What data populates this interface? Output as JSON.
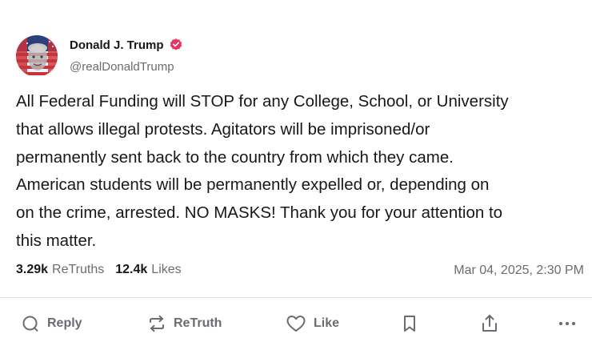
{
  "author": {
    "display_name": "Donald J. Trump",
    "handle": "@realDonaldTrump",
    "verified": true,
    "verified_color": "#e8345f"
  },
  "post": {
    "lines": [
      "All Federal Funding will STOP for any College, School, or University",
      "that allows illegal protests. Agitators will be imprisoned/or",
      "permanently sent back to the country from which they came.",
      "American students will be permanently expelled or, depending on",
      "on the crime, arrested. NO MASKS! Thank you for your attention to",
      "this matter."
    ]
  },
  "stats": {
    "retruths_count": "3.29k",
    "retruths_label": "ReTruths",
    "likes_count": "12.4k",
    "likes_label": "Likes"
  },
  "timestamp": "Mar 04, 2025, 2:30 PM",
  "actions": {
    "reply_label": "Reply",
    "retruth_label": "ReTruth",
    "like_label": "Like",
    "bookmark_icon": "bookmark-icon",
    "share_icon": "share-icon",
    "more_icon": "more-icon"
  },
  "colors": {
    "text": "#18181b",
    "muted": "#6b6b73",
    "divider": "#e6e6ea"
  }
}
